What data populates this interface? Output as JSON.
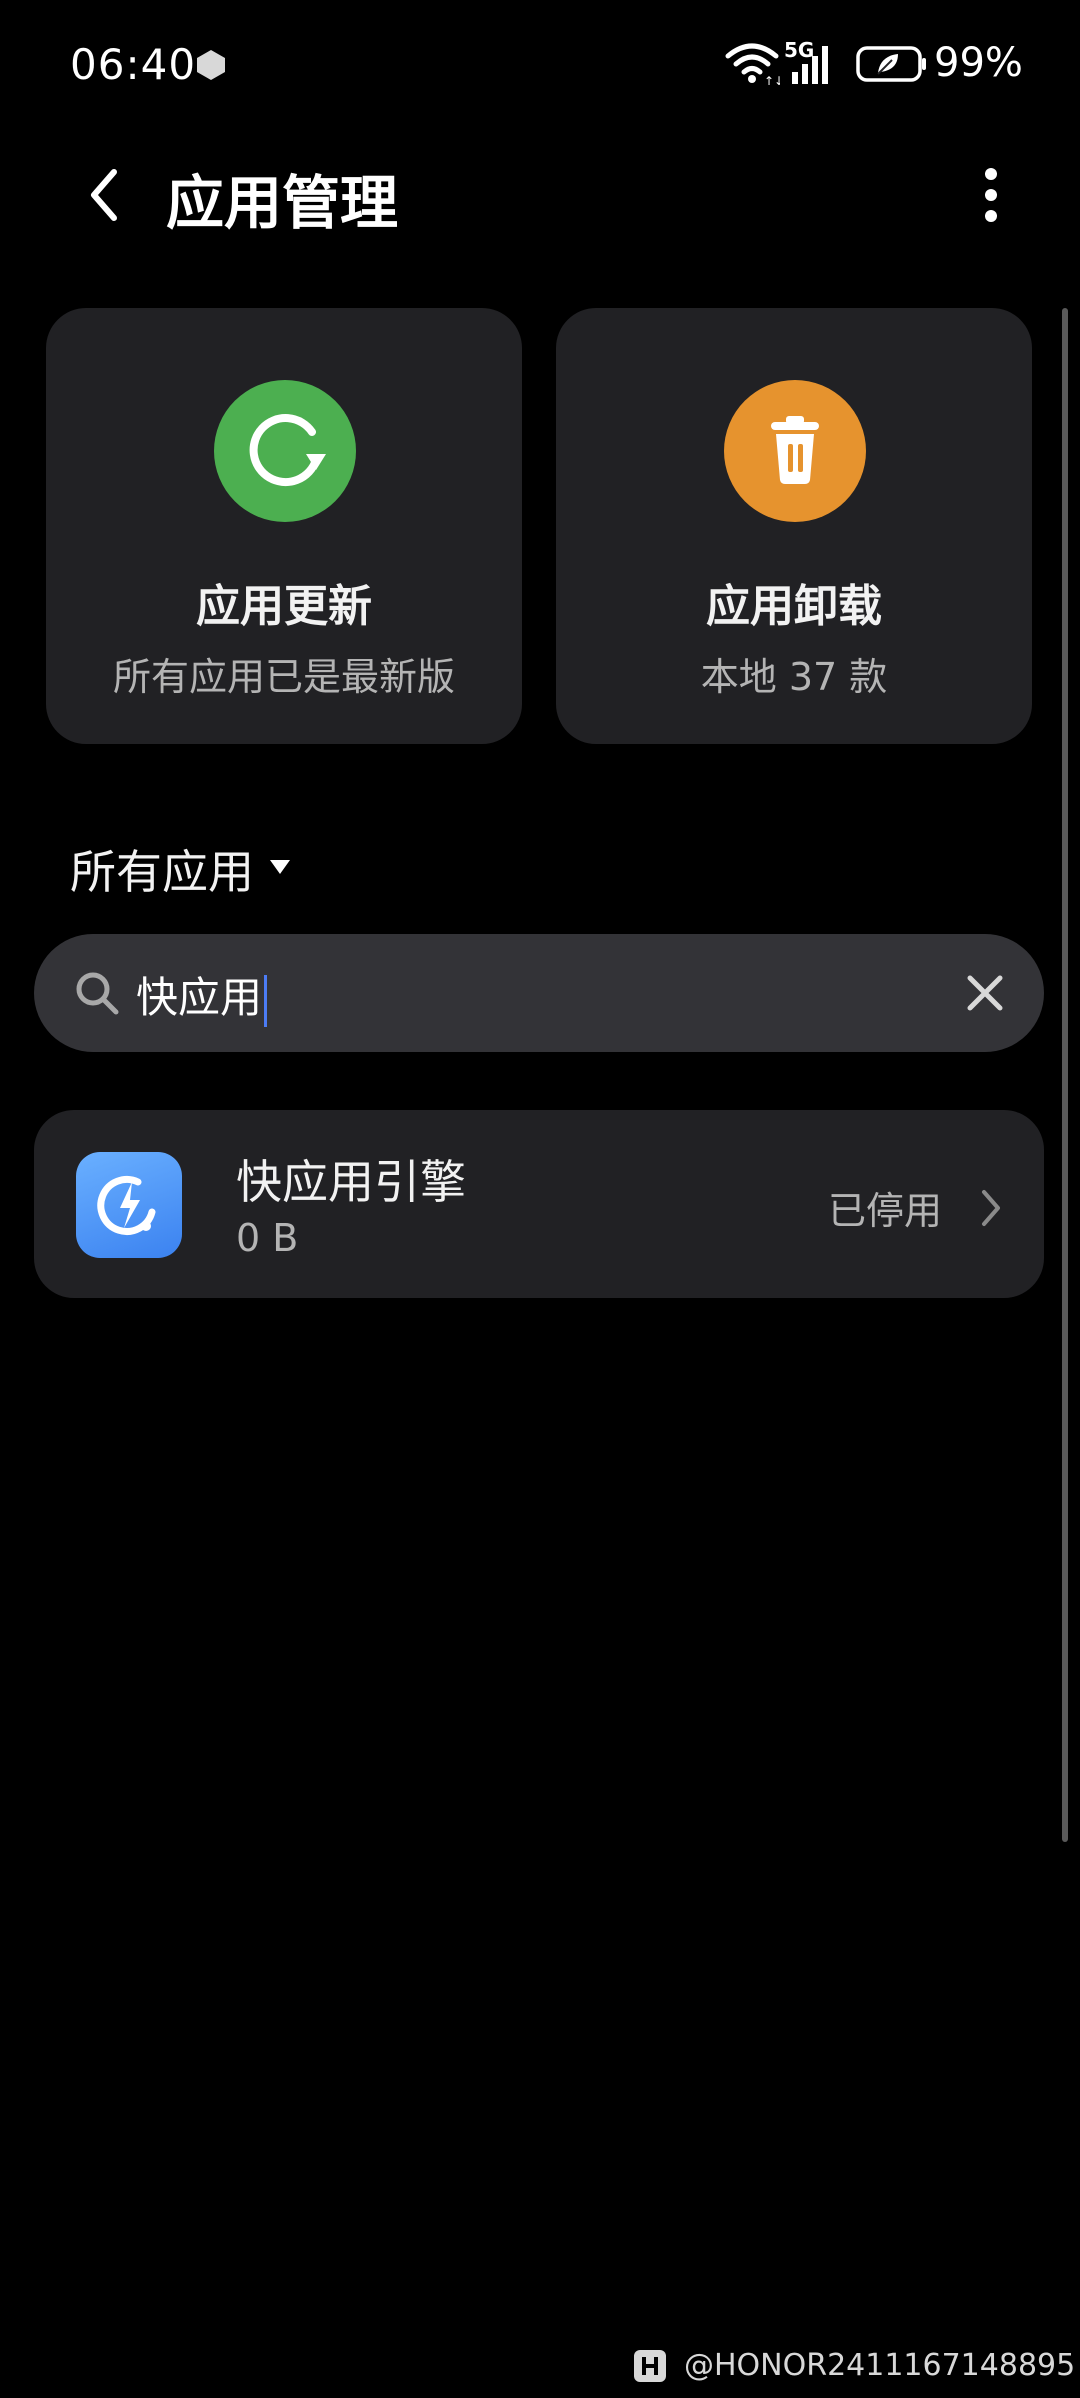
{
  "status_bar": {
    "time": "06:40",
    "network": "5G",
    "battery": "99%"
  },
  "header": {
    "title": "应用管理"
  },
  "cards": {
    "update": {
      "title": "应用更新",
      "subtitle": "所有应用已是最新版",
      "color": "#4caf50"
    },
    "uninstall": {
      "title": "应用卸载",
      "subtitle": "本地 37 款",
      "color": "#e6932e"
    }
  },
  "filter": {
    "label": "所有应用"
  },
  "search": {
    "value": "快应用"
  },
  "results": [
    {
      "name": "快应用引擎",
      "size": "0 B",
      "status": "已停用"
    }
  ],
  "watermark": {
    "text": "@HONOR2411167148895"
  }
}
